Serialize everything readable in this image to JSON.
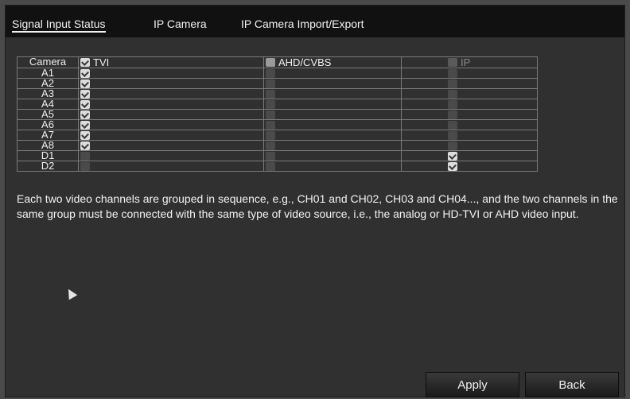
{
  "tabs": [
    {
      "label": "Signal Input Status",
      "active": true
    },
    {
      "label": "IP Camera",
      "active": false
    },
    {
      "label": "IP Camera Import/Export",
      "active": false
    }
  ],
  "table": {
    "headers": [
      "Camera",
      "TVI",
      "AHD/CVBS",
      "IP"
    ],
    "header_checks": [
      "checked",
      "unchecked",
      "disabled"
    ],
    "rows": [
      {
        "camera": "A1",
        "tvi": "checked",
        "ahd": "disabled",
        "ip": "disabled"
      },
      {
        "camera": "A2",
        "tvi": "checked",
        "ahd": "disabled",
        "ip": "disabled"
      },
      {
        "camera": "A3",
        "tvi": "checked",
        "ahd": "disabled",
        "ip": "disabled"
      },
      {
        "camera": "A4",
        "tvi": "checked",
        "ahd": "disabled",
        "ip": "disabled"
      },
      {
        "camera": "A5",
        "tvi": "checked",
        "ahd": "disabled",
        "ip": "disabled"
      },
      {
        "camera": "A6",
        "tvi": "checked",
        "ahd": "disabled",
        "ip": "disabled"
      },
      {
        "camera": "A7",
        "tvi": "checked",
        "ahd": "disabled",
        "ip": "disabled"
      },
      {
        "camera": "A8",
        "tvi": "checked",
        "ahd": "disabled",
        "ip": "disabled"
      },
      {
        "camera": "D1",
        "tvi": "disabled",
        "ahd": "disabled",
        "ip": "checked"
      },
      {
        "camera": "D2",
        "tvi": "disabled",
        "ahd": "disabled",
        "ip": "checked"
      }
    ]
  },
  "note": "Each two video channels are grouped in sequence, e.g., CH01 and CH02, CH03 and CH04..., and the two channels in the same group must be connected with the same type of video source, i.e., the analog or HD-TVI or AHD video input.",
  "buttons": {
    "apply": "Apply",
    "back": "Back"
  },
  "icons": {
    "cursor": "mouse-pointer-icon",
    "check": "checkbox-icon"
  },
  "colors": {
    "background": "#303030",
    "tabbar": "#111111",
    "grid_line": "#7a7a7a"
  }
}
